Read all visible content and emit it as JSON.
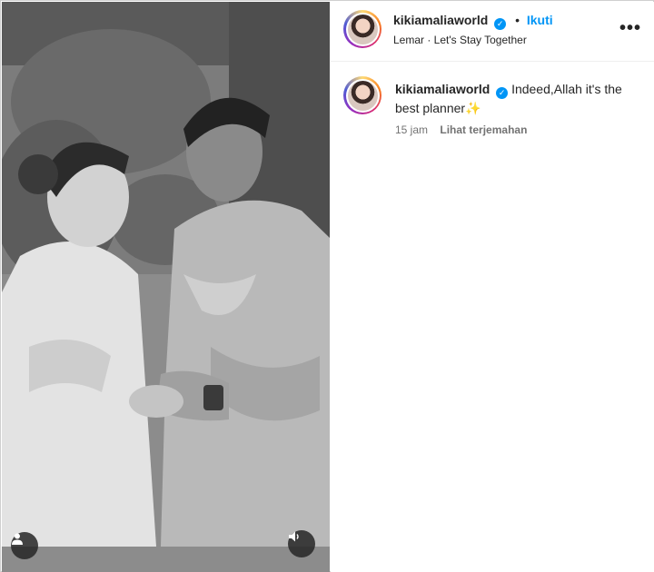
{
  "post": {
    "username": "kikiamaliaworld",
    "separator": "•",
    "follow_label": "Ikuti",
    "audio_line": "Lemar · Let's Stay Together",
    "more_label": "•••"
  },
  "caption": {
    "username": "kikiamaliaworld",
    "text": "Indeed,Allah it's the best planner",
    "emoji": "✨",
    "time": "15 jam",
    "translate_label": "Lihat terjemahan"
  },
  "icons": {
    "verified": "✓",
    "user_tag": "user-tag-icon",
    "audio": "speaker-icon"
  },
  "colors": {
    "link": "#0095f6",
    "verified": "#0095f6",
    "meta": "#737373"
  }
}
